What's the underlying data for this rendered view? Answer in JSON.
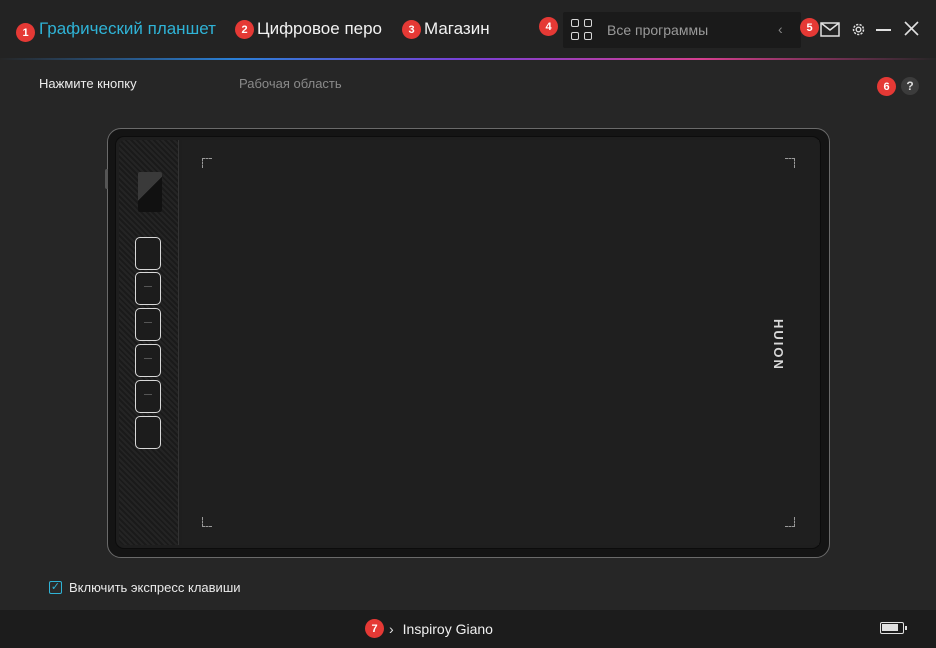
{
  "header": {
    "tabs": [
      {
        "label": "Графический планшет",
        "badge": "1",
        "active": true
      },
      {
        "label": "Цифровое перо",
        "badge": "2",
        "active": false
      },
      {
        "label": "Магазин",
        "badge": "3",
        "active": false
      }
    ],
    "apps": {
      "badge": "4",
      "label": "Все программы",
      "icon": "apps-grid-icon"
    },
    "mail_badge": "5",
    "icons": [
      "mail-icon",
      "gear-icon",
      "minimize-icon",
      "close-icon"
    ]
  },
  "subtabs": {
    "press_button": "Нажмите кнопку",
    "work_area": "Рабочая область",
    "help_badge": "6",
    "help_label": "?"
  },
  "tablet": {
    "brand": "HUION",
    "express_keys_count": 6
  },
  "options": {
    "enable_express_keys_label": "Включить экспресс клавиши",
    "enable_express_keys_checked": true
  },
  "footer": {
    "badge": "7",
    "device_name": "Inspiroy Giano",
    "battery_level": 0.9
  },
  "colors": {
    "accent": "#2fb3d6",
    "badge": "#e53935",
    "background": "#262626"
  }
}
